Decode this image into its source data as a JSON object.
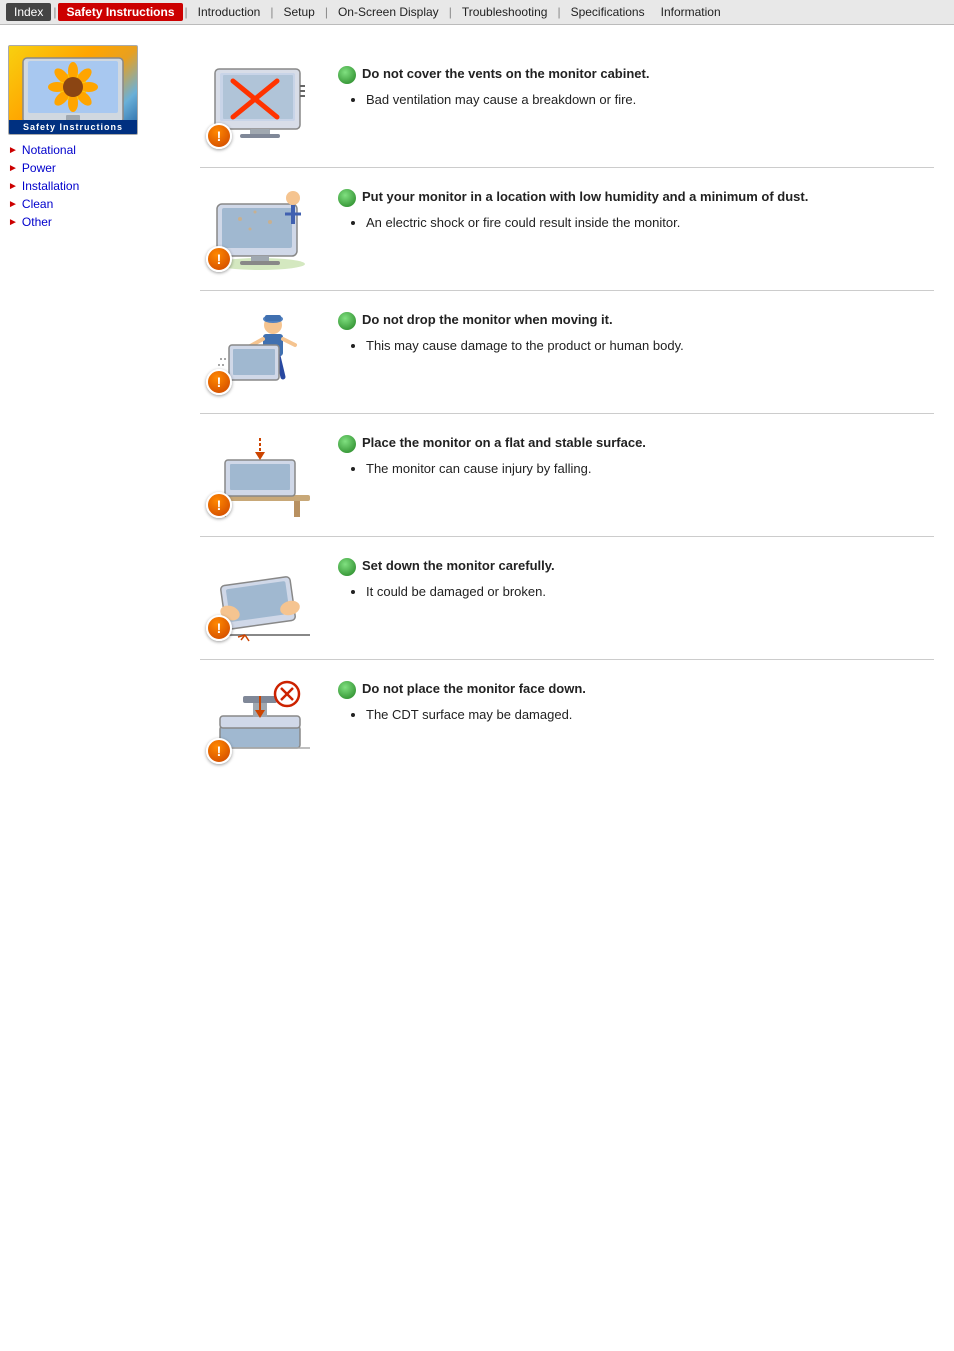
{
  "navbar": {
    "items": [
      {
        "label": "Index",
        "class": "index"
      },
      {
        "label": "Safety Instructions",
        "class": "active"
      },
      {
        "label": "Introduction"
      },
      {
        "label": "Setup"
      },
      {
        "label": "On-Screen Display"
      },
      {
        "label": "Troubleshooting"
      },
      {
        "label": "Specifications"
      },
      {
        "label": "Information"
      }
    ]
  },
  "sidebar": {
    "logo_label": "Safety Instructions",
    "nav_items": [
      {
        "label": "Notational",
        "active": false
      },
      {
        "label": "Power",
        "active": false
      },
      {
        "label": "Installation",
        "active": false
      },
      {
        "label": "Clean",
        "active": false
      },
      {
        "label": "Other",
        "active": false
      }
    ]
  },
  "instructions": [
    {
      "id": 1,
      "title": "Do not cover the vents on the monitor cabinet.",
      "bullets": [
        "Bad ventilation may cause a breakdown or fire."
      ]
    },
    {
      "id": 2,
      "title": "Put your monitor in a location with low humidity and a minimum of dust.",
      "bullets": [
        "An electric shock or fire could result inside the monitor."
      ]
    },
    {
      "id": 3,
      "title": "Do not drop the monitor when moving it.",
      "bullets": [
        "This may cause damage to the product or human body."
      ]
    },
    {
      "id": 4,
      "title": "Place the monitor on a flat and stable surface.",
      "bullets": [
        "The monitor can cause injury by falling."
      ]
    },
    {
      "id": 5,
      "title": "Set down the monitor carefully.",
      "bullets": [
        "It could be damaged or broken."
      ]
    },
    {
      "id": 6,
      "title": "Do not place the monitor face down.",
      "bullets": [
        "The CDT surface may be damaged."
      ]
    }
  ]
}
